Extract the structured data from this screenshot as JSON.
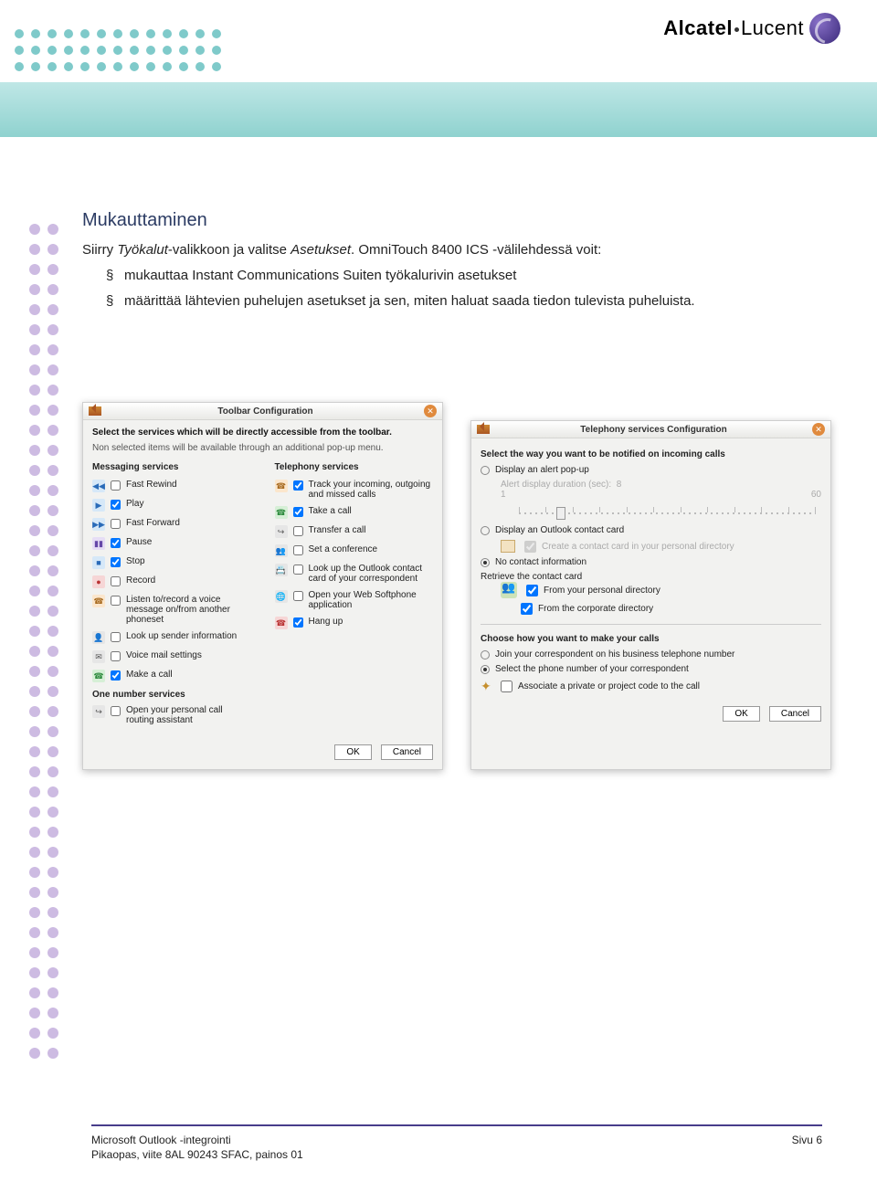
{
  "header": {
    "logo_text_a": "Alcatel",
    "logo_text_b": "Lucent"
  },
  "doc": {
    "title": "Mukauttaminen",
    "intro_prefix": "Siirry ",
    "intro_em1": "Työkalut",
    "intro_mid": "-valikkoon ja valitse ",
    "intro_em2": "Asetukset",
    "intro_suffix": ". OmniTouch 8400 ICS -välilehdessä voit:",
    "bullets": [
      "mukauttaa Instant Communications Suiten työkalurivin asetukset",
      "määrittää lähtevien puhelujen asetukset ja sen, miten haluat saada tiedon tulevista puheluista."
    ]
  },
  "left_window": {
    "title": "Toolbar Configuration",
    "instr": "Select the services which will be directly accessible from the toolbar.",
    "instr_sub": "Non selected items will be available through an additional pop-up menu.",
    "messaging_header": "Messaging services",
    "telephony_header": "Telephony services",
    "messaging": [
      {
        "icon": "i-blue",
        "glyph": "◀◀",
        "checked": false,
        "label": "Fast Rewind"
      },
      {
        "icon": "i-blue",
        "glyph": "▶",
        "checked": true,
        "label": "Play"
      },
      {
        "icon": "i-blue",
        "glyph": "▶▶",
        "checked": false,
        "label": "Fast Forward"
      },
      {
        "icon": "i-purple",
        "glyph": "▮▮",
        "checked": true,
        "label": "Pause"
      },
      {
        "icon": "i-blue",
        "glyph": "■",
        "checked": true,
        "label": "Stop"
      },
      {
        "icon": "i-red",
        "glyph": "●",
        "checked": false,
        "label": "Record"
      },
      {
        "icon": "i-orange",
        "glyph": "☎",
        "checked": false,
        "label": "Listen to/record a voice message on/from another phoneset"
      },
      {
        "icon": "i-grey",
        "glyph": "👤",
        "checked": false,
        "label": "Look up sender information"
      },
      {
        "icon": "i-grey",
        "glyph": "✉",
        "checked": false,
        "label": "Voice mail settings"
      },
      {
        "icon": "i-green",
        "glyph": "☎",
        "checked": true,
        "label": "Make a call"
      }
    ],
    "one_number_header": "One number services",
    "one_number_item": {
      "icon": "i-grey",
      "glyph": "↪",
      "checked": false,
      "label": "Open your personal call routing assistant"
    },
    "telephony": [
      {
        "icon": "i-orange",
        "glyph": "☎",
        "checked": true,
        "label": "Track your incoming, outgoing and missed calls"
      },
      {
        "icon": "i-green",
        "glyph": "☎",
        "checked": true,
        "label": "Take a call"
      },
      {
        "icon": "i-grey",
        "glyph": "↪",
        "checked": false,
        "label": "Transfer a call"
      },
      {
        "icon": "i-grey",
        "glyph": "👥",
        "checked": false,
        "label": "Set a conference"
      },
      {
        "icon": "i-grey",
        "glyph": "📇",
        "checked": false,
        "label": "Look up the Outlook contact card of your correspondent"
      },
      {
        "icon": "i-grey",
        "glyph": "🌐",
        "checked": false,
        "label": "Open your Web Softphone application"
      },
      {
        "icon": "i-red",
        "glyph": "☎",
        "checked": true,
        "label": "Hang up"
      }
    ],
    "ok": "OK",
    "cancel": "Cancel"
  },
  "right_window": {
    "title": "Telephony services Configuration",
    "sec1_h": "Select the way you want to be notified on incoming calls",
    "opt1": "Display an alert pop-up",
    "slider_label": "Alert display duration (sec):",
    "slider_value": "8",
    "slider_min": "1",
    "slider_max": "60",
    "opt2": "Display an Outlook contact card",
    "opt2_sub": "Create a contact card in your personal directory",
    "opt3": "No contact information",
    "retrieve_h": "Retrieve the contact card",
    "retrieve_items": [
      {
        "checked": true,
        "label": "From your personal directory"
      },
      {
        "checked": true,
        "label": "From the corporate directory"
      }
    ],
    "sec2_h": "Choose how you want to make your calls",
    "call_opt1": "Join your correspondent on his business telephone number",
    "call_opt2": "Select the phone number of your correspondent",
    "assoc": "Associate a private or project code to the call",
    "ok": "OK",
    "cancel": "Cancel"
  },
  "footer": {
    "line1": "Microsoft Outlook -integrointi",
    "line2": "Pikaopas, viite 8AL 90243 SFAC, painos 01",
    "page": "Sivu 6"
  }
}
